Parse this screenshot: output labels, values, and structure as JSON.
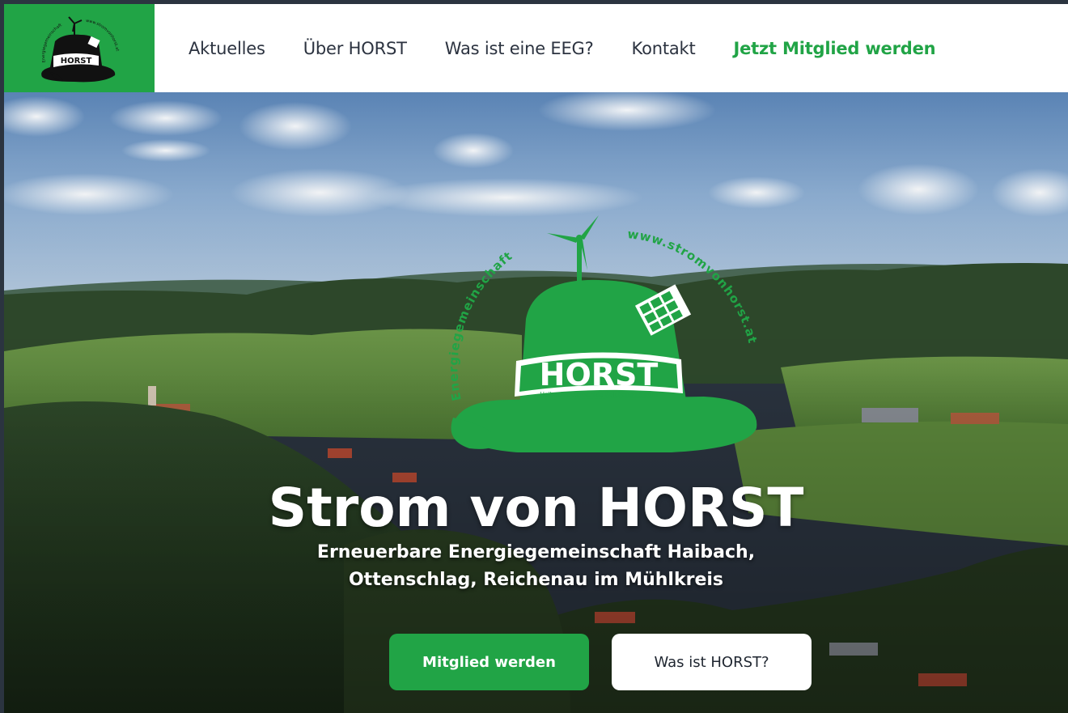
{
  "nav": {
    "logo_text": "HORST",
    "logo_ring_left": "Energiegemeinschaft",
    "logo_ring_right": "www.stromvonhorst.at",
    "items": [
      {
        "label": "Aktuelles"
      },
      {
        "label": "Über HORST"
      },
      {
        "label": "Was ist eine EEG?"
      },
      {
        "label": "Kontakt"
      },
      {
        "label": "Jetzt Mitglied werden"
      }
    ]
  },
  "hero": {
    "logo": {
      "text": "HORST",
      "tagline": "Haibach Ottenschlag Reichenau STrom",
      "ring_left": "Energiegemeinschaft",
      "ring_right": "www.stromvonhorst.at"
    },
    "title": "Strom von HORST",
    "subtitle_line1": "Erneuerbare Energiegemeinschaft Haibach,",
    "subtitle_line2": "Ottenschlag, Reichenau im Mühlkreis",
    "primary_button": "Mitglied werden",
    "secondary_button": "Was ist HORST?"
  },
  "colors": {
    "brand_green": "#21a446",
    "nav_text": "#2c3340",
    "white": "#ffffff"
  }
}
